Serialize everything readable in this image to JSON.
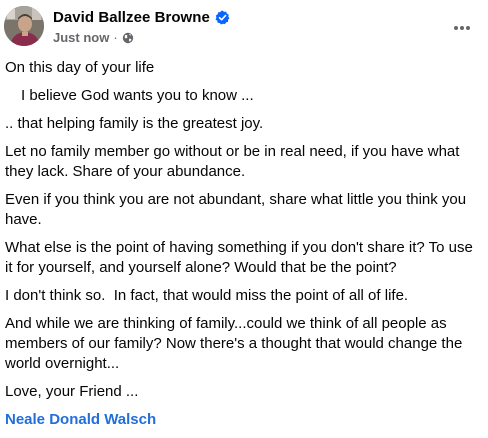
{
  "post": {
    "author": {
      "name": "David Ballzee Browne",
      "verified_icon": "verified-badge-icon",
      "avatar_icon": "profile-photo"
    },
    "meta": {
      "timestamp": "Just now",
      "separator": "·",
      "audience_icon": "globe-icon"
    },
    "menu_icon": "more-options-icon",
    "paragraphs": [
      "On this day of your life",
      "I believe God wants you to know ...",
      ".. that helping family is the greatest joy.",
      "Let no family member go without or be in real need, if you have what they lack. Share of your abundance.",
      "Even if you think you are not abundant, share what little you think you have.",
      "What else is the point of having something if you don't share it? To use it for yourself, and yourself alone? Would that be the point?",
      "I don't think so.  In fact, that would miss the point of all of life.",
      "And while we are thinking of family...could we think of all people as members of our family? Now there's a thought that would change the world overnight...",
      "Love, your Friend ..."
    ],
    "signature": "Neale Donald Walsch",
    "colors": {
      "link": "#216fdb",
      "verified": "#0866ff",
      "secondary_text": "#65676b",
      "primary_text": "#050505"
    }
  }
}
